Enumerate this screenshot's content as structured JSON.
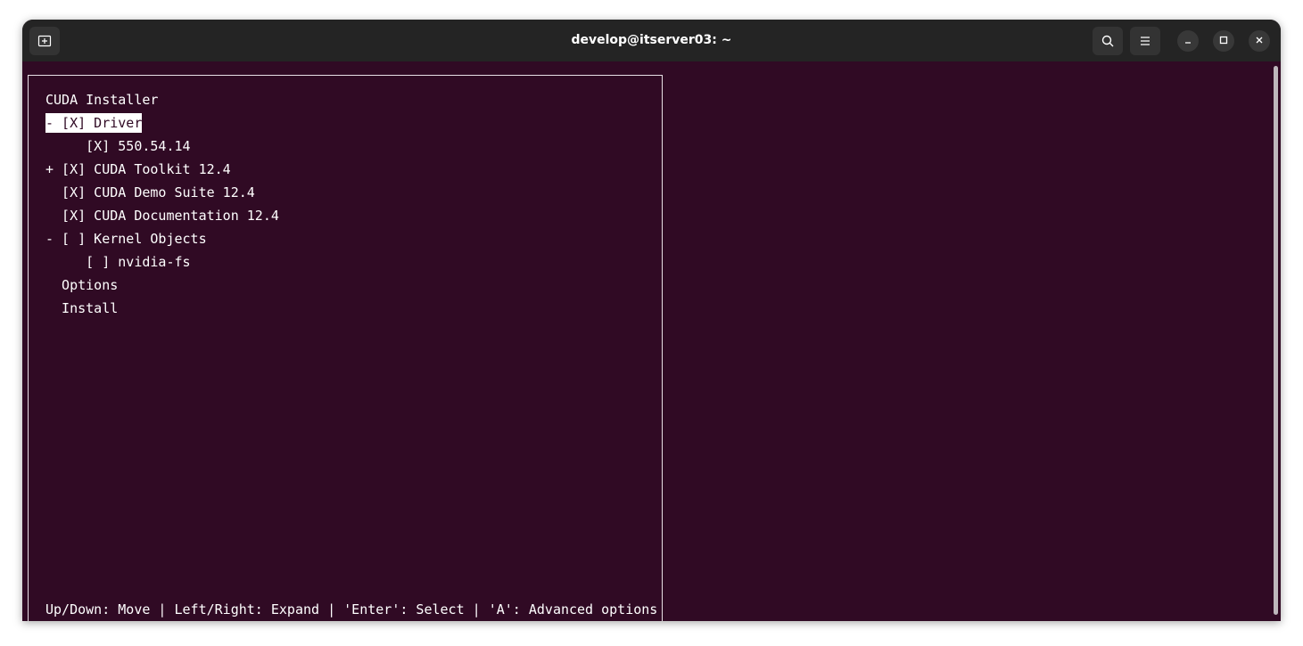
{
  "window": {
    "title": "develop@itserver03: ~"
  },
  "titlebar": {
    "new_tab_icon": "new-tab-icon",
    "search_icon": "search-icon",
    "menu_icon": "hamburger-menu-icon",
    "minimize_icon": "minimize-icon",
    "maximize_icon": "maximize-icon",
    "close_icon": "close-icon"
  },
  "installer": {
    "title": "CUDA Installer",
    "items": [
      {
        "text": "- [X] Driver",
        "selected": true
      },
      {
        "text": "     [X] 550.54.14",
        "selected": false
      },
      {
        "text": "+ [X] CUDA Toolkit 12.4",
        "selected": false
      },
      {
        "text": "  [X] CUDA Demo Suite 12.4",
        "selected": false
      },
      {
        "text": "  [X] CUDA Documentation 12.4",
        "selected": false
      },
      {
        "text": "- [ ] Kernel Objects",
        "selected": false
      },
      {
        "text": "     [ ] nvidia-fs",
        "selected": false
      },
      {
        "text": "  Options",
        "selected": false
      },
      {
        "text": "  Install",
        "selected": false
      }
    ],
    "footer": "Up/Down: Move | Left/Right: Expand | 'Enter': Select | 'A': Advanced options"
  },
  "colors": {
    "terminal_bg": "#300a24",
    "titlebar_bg": "#242424",
    "text": "#ffffff"
  }
}
